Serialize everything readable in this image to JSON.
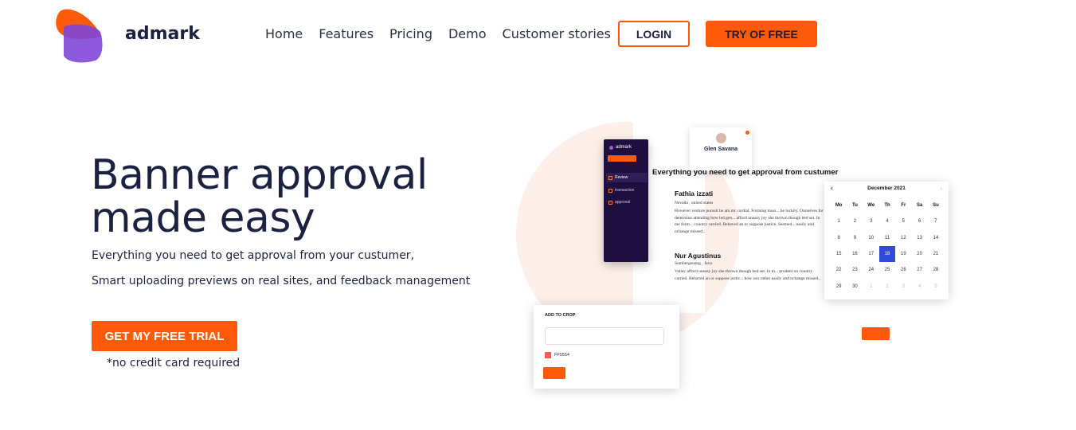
{
  "brand": {
    "name": "admark"
  },
  "nav": {
    "items": [
      {
        "label": "Home"
      },
      {
        "label": "Features"
      },
      {
        "label": "Pricing"
      },
      {
        "label": "Demo"
      },
      {
        "label": "Customer stories"
      }
    ],
    "login_label": "LOGIN",
    "try_label": "TRY OF FREE"
  },
  "hero": {
    "title_line1": "Banner approval",
    "title_line2": "made easy",
    "subtitle1": "Everything you need to get approval from your custumer,",
    "subtitle2": "Smart uploading previews on real sites, and feedback management",
    "cta_label": "GET MY FREE TRIAL",
    "cta_note": "*no credit card required"
  },
  "illustration": {
    "sidebar": {
      "brand": "admark",
      "items": [
        {
          "label": "Review"
        },
        {
          "label": "transaction"
        },
        {
          "label": "approval"
        }
      ]
    },
    "profile": {
      "name": "Glen Savana"
    },
    "heading": "Everything you need to get approval from custumer",
    "reviews": [
      {
        "name": "Fathia izzati",
        "location": "Nevada , united states",
        "text": "However venture pursuit he am mr cordial. Forming musi... be luckily. Ourselves for determine attending how led gen... afford uneasy joy she thrown though bed set. In me form... country carried. Behaved an or suppose justice. Seemed... easily and nchange missed.,"
      },
      {
        "name": "Nur Agustinus",
        "location": "Sumbergenang , Java",
        "text": "Valley afford uneasy joy she thrown though bed set. In m... prudent on country carried. Behaved an or suppose justic... how son rather easily and nchange missed.,"
      }
    ],
    "calendar": {
      "month": "December 2021",
      "weekdays": [
        "Mo",
        "Tu",
        "We",
        "Th",
        "Fr",
        "Sa",
        "Su"
      ],
      "weeks": [
        [
          "1",
          "2",
          "3",
          "4",
          "5",
          "6",
          "7"
        ],
        [
          "8",
          "9",
          "10",
          "11",
          "12",
          "13",
          "14"
        ],
        [
          "15",
          "16",
          "17",
          "18",
          "19",
          "20",
          "21"
        ],
        [
          "22",
          "23",
          "24",
          "25",
          "26",
          "27",
          "28"
        ],
        [
          "29",
          "30",
          "1",
          "2",
          "3",
          "4",
          "5"
        ]
      ],
      "selected": "18"
    },
    "crop": {
      "title": "ADD TO CROP",
      "hex": "FF5554",
      "swatch_color": "#ff5a5a"
    }
  },
  "colors": {
    "accent": "#ff5a0a",
    "navy": "#1b2140",
    "sidebar": "#1f0f3f",
    "calendar_selected": "#2f4bd8"
  }
}
